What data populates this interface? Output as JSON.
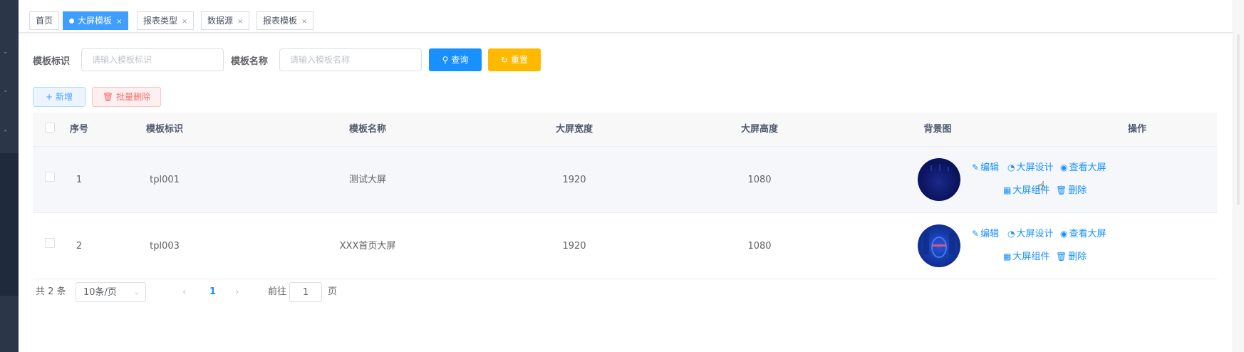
{
  "tabs": [
    {
      "label": "首页",
      "active": false,
      "closable": false
    },
    {
      "label": "大屏模板",
      "active": true,
      "closable": true
    },
    {
      "label": "报表类型",
      "active": false,
      "closable": true
    },
    {
      "label": "数据源",
      "active": false,
      "closable": true
    },
    {
      "label": "报表模板",
      "active": false,
      "closable": true
    }
  ],
  "tab_close": "×",
  "search": {
    "id_label": "模板标识",
    "id_placeholder": "请输入模板标识",
    "name_label": "模板名称",
    "name_placeholder": "请输入模板名称",
    "query_label": "查询",
    "reset_label": "重置"
  },
  "toolbar": {
    "add_label": "新增",
    "batch_delete_label": "批量删除"
  },
  "table": {
    "columns": [
      "序号",
      "模板标识",
      "模板名称",
      "大屏宽度",
      "大屏高度",
      "背景图",
      "操作"
    ],
    "rows": [
      {
        "index": "1",
        "id": "tpl001",
        "name": "测试大屏",
        "width": "1920",
        "height": "1080"
      },
      {
        "index": "2",
        "id": "tpl003",
        "name": "XXX首页大屏",
        "width": "1920",
        "height": "1080"
      }
    ],
    "actions": {
      "edit": "编辑",
      "design": "大屏设计",
      "view": "查看大屏",
      "component": "大屏组件",
      "delete": "删除"
    }
  },
  "pagination": {
    "total_text": "共 2 条",
    "page_size": "10条/页",
    "current_page": "1",
    "goto_prefix": "前往",
    "goto_value": "1",
    "goto_suffix": "页"
  },
  "colors": {
    "primary": "#1890ff",
    "warning": "#ffba00",
    "danger": "#f56c6c",
    "sidebar": "#2b3649"
  }
}
